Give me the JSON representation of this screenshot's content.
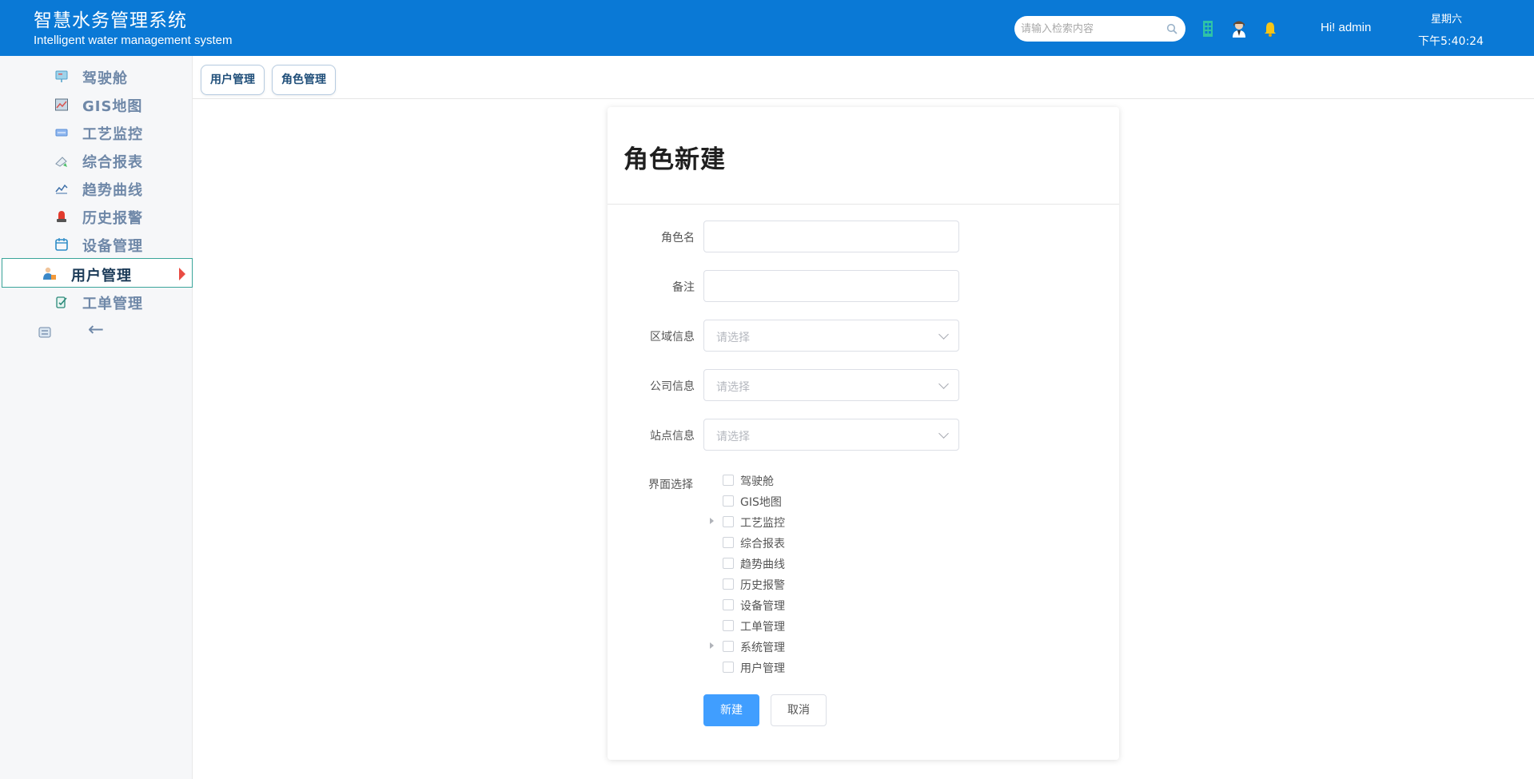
{
  "header": {
    "title": "智慧水务管理系统",
    "subtitle": "Intelligent water management system",
    "search_placeholder": "请输入检索内容",
    "greeting": "Hi!  admin",
    "weekday": "星期六",
    "time": "下午5:40:24",
    "icons": [
      "building-icon",
      "user-avatar-icon",
      "bell-icon"
    ]
  },
  "sidebar": {
    "items": [
      {
        "label": "驾驶舱",
        "icon": "cockpit-icon"
      },
      {
        "label": "GIS地图",
        "icon": "map-icon"
      },
      {
        "label": "工艺监控",
        "icon": "monitor-icon"
      },
      {
        "label": "综合报表",
        "icon": "report-icon"
      },
      {
        "label": "趋势曲线",
        "icon": "trend-icon"
      },
      {
        "label": "历史报警",
        "icon": "alarm-icon"
      },
      {
        "label": "设备管理",
        "icon": "device-icon"
      },
      {
        "label": "用户管理",
        "icon": "user-manage-icon",
        "active": true
      },
      {
        "label": "工单管理",
        "icon": "workorder-icon"
      }
    ],
    "collapse_label": "←"
  },
  "tabs": [
    {
      "label": "用户管理"
    },
    {
      "label": "角色管理"
    }
  ],
  "form": {
    "title": "角色新建",
    "fields": {
      "role_name": {
        "label": "角色名",
        "value": ""
      },
      "remark": {
        "label": "备注",
        "value": ""
      },
      "region": {
        "label": "区域信息",
        "placeholder": "请选择"
      },
      "company": {
        "label": "公司信息",
        "placeholder": "请选择"
      },
      "station": {
        "label": "站点信息",
        "placeholder": "请选择"
      }
    },
    "tree_label": "界面选择",
    "tree": [
      {
        "label": "驾驶舱",
        "expandable": false
      },
      {
        "label": "GIS地图",
        "expandable": false
      },
      {
        "label": "工艺监控",
        "expandable": true
      },
      {
        "label": "综合报表",
        "expandable": false
      },
      {
        "label": "趋势曲线",
        "expandable": false
      },
      {
        "label": "历史报警",
        "expandable": false
      },
      {
        "label": "设备管理",
        "expandable": false
      },
      {
        "label": "工单管理",
        "expandable": false
      },
      {
        "label": "系统管理",
        "expandable": true
      },
      {
        "label": "用户管理",
        "expandable": false
      }
    ],
    "submit_label": "新建",
    "cancel_label": "取消"
  },
  "colors": {
    "header_bg": "#0a79d6",
    "primary": "#409eff",
    "active_border": "#3aa59a",
    "active_arrow": "#e94c43"
  }
}
